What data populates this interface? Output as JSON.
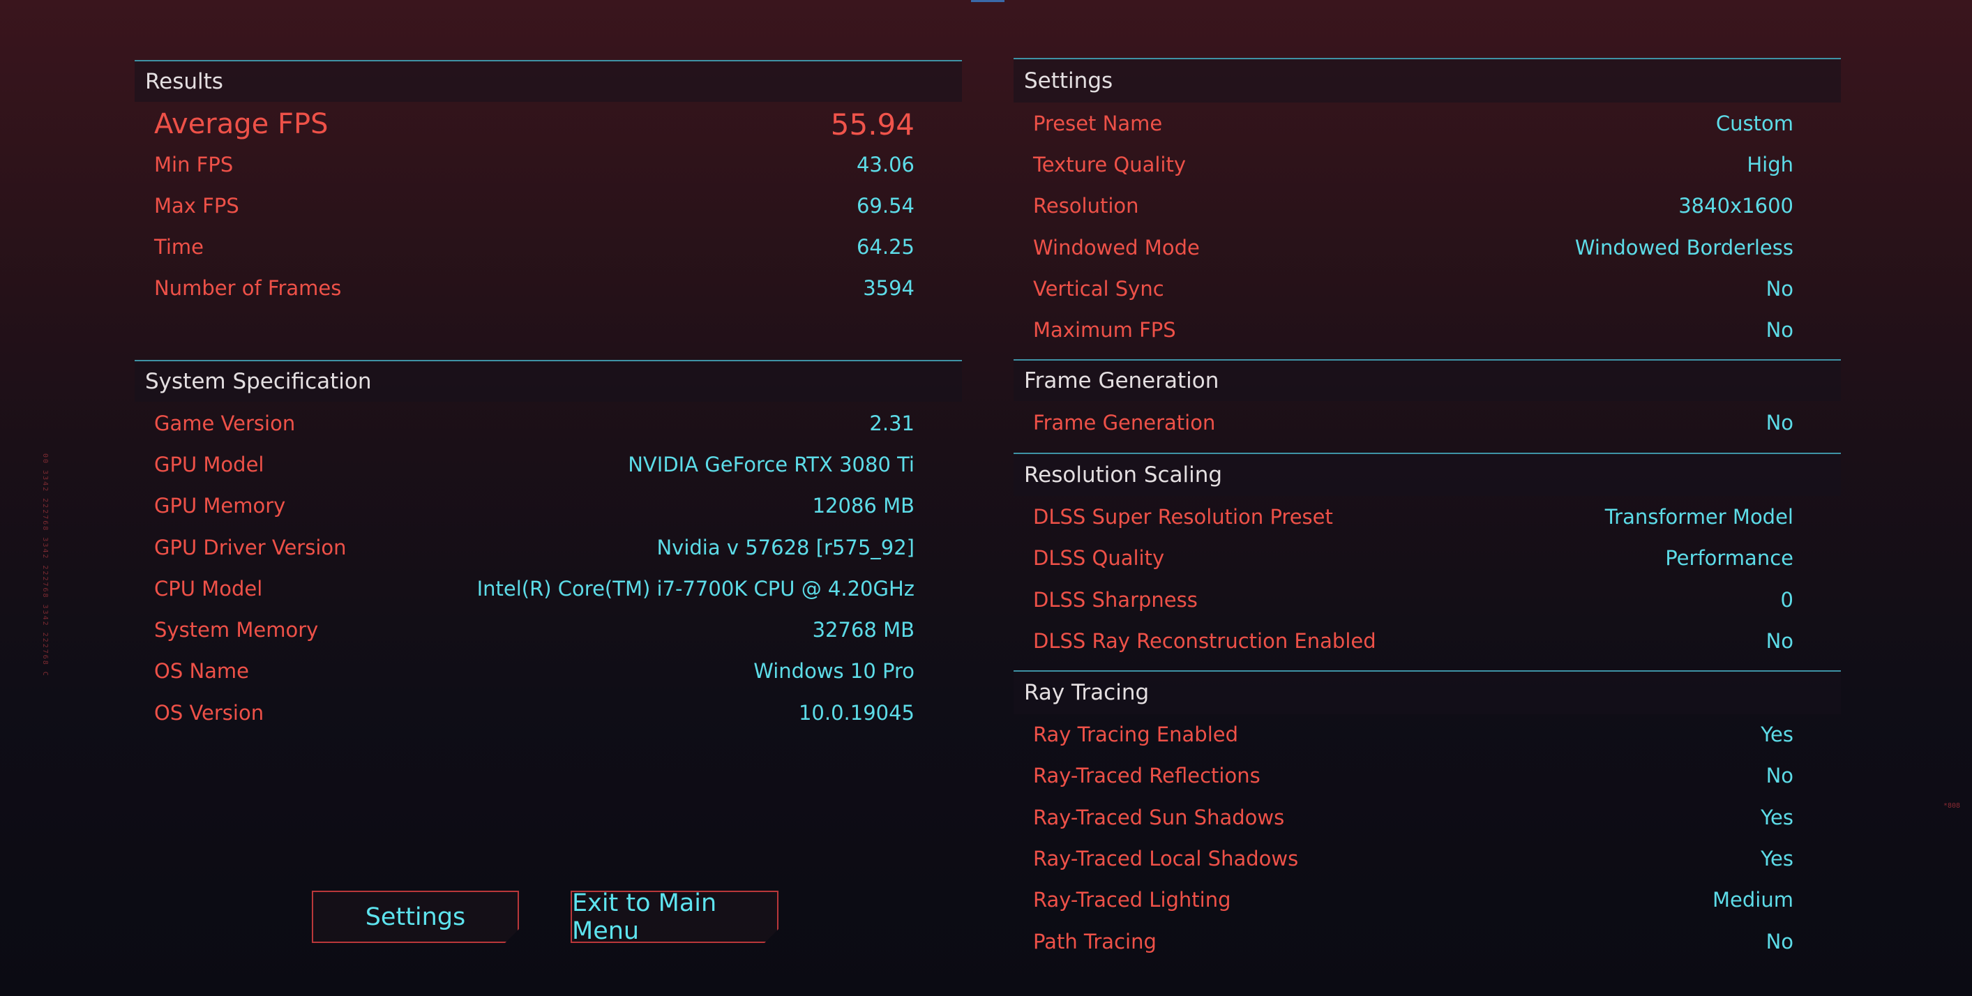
{
  "results": {
    "header": "Results",
    "average_fps": {
      "label": "Average FPS",
      "value": "55.94"
    },
    "rows": [
      {
        "label": "Min FPS",
        "value": "43.06"
      },
      {
        "label": "Max FPS",
        "value": "69.54"
      },
      {
        "label": "Time",
        "value": "64.25"
      },
      {
        "label": "Number of Frames",
        "value": "3594"
      }
    ]
  },
  "system": {
    "header": "System Specification",
    "rows": [
      {
        "label": "Game Version",
        "value": "2.31"
      },
      {
        "label": "GPU Model",
        "value": "NVIDIA GeForce RTX 3080 Ti"
      },
      {
        "label": "GPU Memory",
        "value": "12086 MB"
      },
      {
        "label": "GPU Driver Version",
        "value": "Nvidia v 57628 [r575_92]"
      },
      {
        "label": "CPU Model",
        "value": "Intel(R) Core(TM) i7-7700K CPU @ 4.20GHz"
      },
      {
        "label": "System Memory",
        "value": "32768 MB"
      },
      {
        "label": "OS Name",
        "value": "Windows 10 Pro"
      },
      {
        "label": "OS Version",
        "value": "10.0.19045"
      }
    ]
  },
  "settings": {
    "header": "Settings",
    "rows": [
      {
        "label": "Preset Name",
        "value": "Custom"
      },
      {
        "label": "Texture Quality",
        "value": "High"
      },
      {
        "label": "Resolution",
        "value": "3840x1600"
      },
      {
        "label": "Windowed Mode",
        "value": "Windowed Borderless"
      },
      {
        "label": "Vertical Sync",
        "value": "No"
      },
      {
        "label": "Maximum FPS",
        "value": "No"
      }
    ]
  },
  "frame_generation": {
    "header": "Frame Generation",
    "rows": [
      {
        "label": "Frame Generation",
        "value": "No"
      }
    ]
  },
  "resolution_scaling": {
    "header": "Resolution Scaling",
    "rows": [
      {
        "label": "DLSS Super Resolution Preset",
        "value": "Transformer Model"
      },
      {
        "label": "DLSS Quality",
        "value": "Performance"
      },
      {
        "label": "DLSS Sharpness",
        "value": "0"
      },
      {
        "label": "DLSS Ray Reconstruction Enabled",
        "value": "No"
      }
    ]
  },
  "ray_tracing": {
    "header": "Ray Tracing",
    "rows": [
      {
        "label": "Ray Tracing Enabled",
        "value": "Yes"
      },
      {
        "label": "Ray-Traced Reflections",
        "value": "No"
      },
      {
        "label": "Ray-Traced Sun Shadows",
        "value": "Yes"
      },
      {
        "label": "Ray-Traced Local Shadows",
        "value": "Yes"
      },
      {
        "label": "Ray-Traced Lighting",
        "value": "Medium"
      },
      {
        "label": "Path Tracing",
        "value": "No"
      }
    ]
  },
  "buttons": {
    "settings": "Settings",
    "exit": "Exit to Main Menu"
  },
  "decor": {
    "side_text": "00 3342 222768 3342 222768 3342 222768 CP",
    "side_mark": "*808"
  },
  "colors": {
    "label": "#ee5148",
    "value": "#5ddce8",
    "accent_line": "#3f93a6",
    "button_border": "#b9373a"
  }
}
